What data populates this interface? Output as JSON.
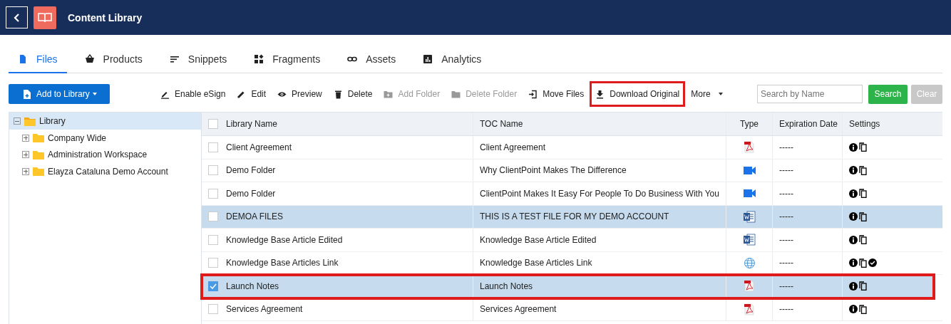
{
  "header": {
    "title": "Content Library"
  },
  "tabs": [
    {
      "label": "Files",
      "kind": "file",
      "selected": true
    },
    {
      "label": "Products",
      "kind": "basket",
      "selected": false
    },
    {
      "label": "Snippets",
      "kind": "lines",
      "selected": false
    },
    {
      "label": "Fragments",
      "kind": "blocks",
      "selected": false
    },
    {
      "label": "Assets",
      "kind": "link",
      "selected": false
    },
    {
      "label": "Analytics",
      "kind": "chart",
      "selected": false
    }
  ],
  "add_button": {
    "label": "Add to Library"
  },
  "toolbar": [
    {
      "label": "Enable eSign",
      "kind": "sign",
      "disabled": false,
      "annotated": false
    },
    {
      "label": "Edit",
      "kind": "pencil",
      "disabled": false,
      "annotated": false
    },
    {
      "label": "Preview",
      "kind": "eye",
      "disabled": false,
      "annotated": false
    },
    {
      "label": "Delete",
      "kind": "trash",
      "disabled": false,
      "annotated": false
    },
    {
      "label": "Add Folder",
      "kind": "folder-plus",
      "disabled": true,
      "annotated": false
    },
    {
      "label": "Delete Folder",
      "kind": "folder",
      "disabled": true,
      "annotated": false
    },
    {
      "label": "Move Files",
      "kind": "move",
      "disabled": false,
      "annotated": false
    },
    {
      "label": "Download Original",
      "kind": "download",
      "disabled": false,
      "annotated": true
    }
  ],
  "more": {
    "label": "More"
  },
  "search": {
    "placeholder": "Search by Name",
    "button": "Search",
    "clear": "Clear"
  },
  "tree": {
    "label": "Library",
    "expanded": true,
    "selected": true,
    "children": [
      {
        "label": "Company Wide",
        "expanded": false
      },
      {
        "label": "Administration Workspace",
        "expanded": false
      },
      {
        "label": "Elayza Cataluna Demo Account",
        "expanded": false
      }
    ]
  },
  "table": {
    "columns": [
      "Library Name",
      "TOC Name",
      "Type",
      "Expiration Date",
      "Settings"
    ],
    "header_checked": false,
    "rows": [
      {
        "name": "Client Agreement",
        "toc": "Client Agreement",
        "kind": "pdf",
        "expiration": "-----",
        "approved": false,
        "checked": false,
        "highlighted": false,
        "annotated": false
      },
      {
        "name": "Demo Folder",
        "toc": "Why ClientPoint Makes The Difference",
        "kind": "video",
        "expiration": "-----",
        "approved": false,
        "checked": false,
        "highlighted": false,
        "annotated": false
      },
      {
        "name": "Demo Folder",
        "toc": "ClientPoint Makes It Easy For People To Do Business With You",
        "kind": "video",
        "expiration": "-----",
        "approved": false,
        "checked": false,
        "highlighted": false,
        "annotated": false
      },
      {
        "name": "DEMOA FILES",
        "toc": "THIS IS A TEST FILE FOR MY DEMO ACCOUNT",
        "kind": "word",
        "expiration": "-----",
        "approved": false,
        "checked": false,
        "highlighted": true,
        "annotated": false
      },
      {
        "name": "Knowledge Base Article Edited",
        "toc": "Knowledge Base Article Edited",
        "kind": "word",
        "expiration": "-----",
        "approved": false,
        "checked": false,
        "highlighted": false,
        "annotated": false
      },
      {
        "name": "Knowledge Base Articles Link",
        "toc": "Knowledge Base Articles Link",
        "kind": "web",
        "expiration": "-----",
        "approved": true,
        "checked": false,
        "highlighted": false,
        "annotated": false
      },
      {
        "name": "Launch Notes",
        "toc": "Launch Notes",
        "kind": "pdf",
        "expiration": "-----",
        "approved": false,
        "checked": true,
        "highlighted": true,
        "annotated": true
      },
      {
        "name": "Services Agreement",
        "toc": "Services Agreement",
        "kind": "pdf",
        "expiration": "-----",
        "approved": false,
        "checked": false,
        "highlighted": false,
        "annotated": false
      }
    ]
  }
}
